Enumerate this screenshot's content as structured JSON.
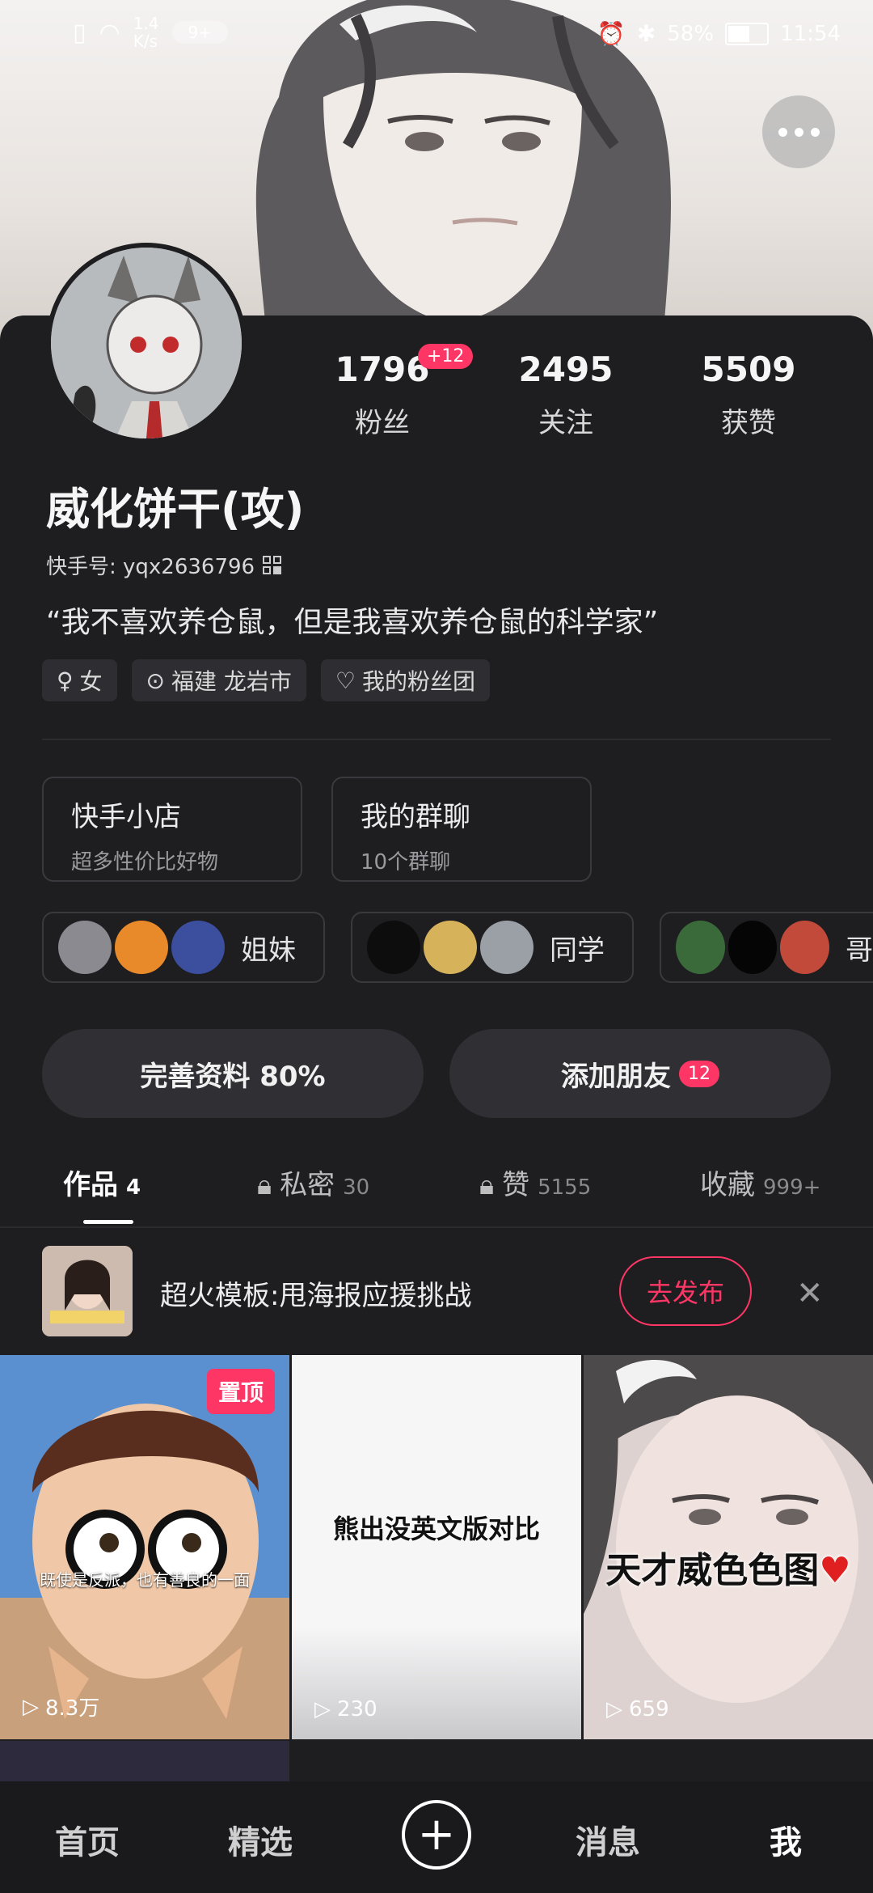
{
  "status_bar": {
    "network_speed": "1.4\nK/s",
    "notif_badge": "9+",
    "battery": "58%",
    "time": "11:54"
  },
  "profile": {
    "stats": [
      {
        "value": "1796",
        "label": "粉丝"
      },
      {
        "value": "2495",
        "label": "关注"
      },
      {
        "value": "5509",
        "label": "获赞"
      }
    ],
    "fans_delta": "+12",
    "name": "威化饼干(攻)",
    "kuaishou_id": "快手号: yqx2636796",
    "bio": "“我不喜欢养仓鼠，但是我喜欢养仓鼠的科学家”",
    "tags": [
      {
        "icon": "gender-female-icon",
        "label": "女"
      },
      {
        "icon": "location-pin-icon",
        "label": "福建 龙岩市"
      },
      {
        "icon": "heart-icon",
        "label": "我的粉丝团"
      }
    ]
  },
  "cards": [
    {
      "title": "快手小店",
      "subtitle": "超多性价比好物"
    },
    {
      "title": "我的群聊",
      "subtitle": "10个群聊"
    }
  ],
  "groups": [
    {
      "label": "姐妹",
      "colors": [
        "#8a8a90",
        "#e98a2a",
        "#3b4f9e"
      ]
    },
    {
      "label": "同学",
      "colors": [
        "#0d0d0d",
        "#d6b35a",
        "#9aa0a6"
      ]
    },
    {
      "label": "哥",
      "colors": [
        "#3a6a3a",
        "#050505",
        "#c24a3a"
      ]
    }
  ],
  "buttons": {
    "complete_profile": "完善资料 80%",
    "add_friend": "添加朋友",
    "add_friend_badge": "12"
  },
  "tabs": [
    {
      "label": "作品",
      "count": "4",
      "locked": false,
      "active": true
    },
    {
      "label": "私密",
      "count": "30",
      "locked": true,
      "active": false
    },
    {
      "label": "赞",
      "count": "5155",
      "locked": true,
      "active": false
    },
    {
      "label": "收藏",
      "count": "999+",
      "locked": false,
      "active": false
    }
  ],
  "promo": {
    "text": "超火模板:甩海报应援挑战",
    "action": "去发布"
  },
  "videos": [
    {
      "plays": "8.3万",
      "pinned_label": "置顶",
      "overlay": "既使是反派，也有善良的一面"
    },
    {
      "plays": "230",
      "caption": "熊出没英文版对比"
    },
    {
      "plays": "659",
      "caption": "天才威色色图"
    }
  ],
  "navbar": {
    "home": "首页",
    "featured": "精选",
    "messages": "消息",
    "me": "我"
  }
}
